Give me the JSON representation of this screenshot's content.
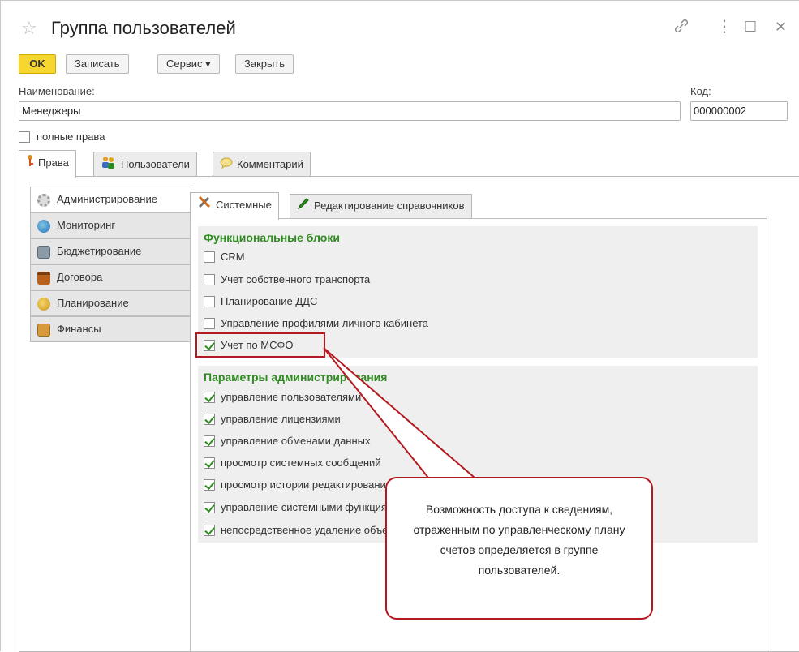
{
  "window": {
    "title": "Группа пользователей",
    "star_icon": "star-icon",
    "link_icon": "link-icon",
    "menu_icon": "more-vertical-icon",
    "maximize_icon": "maximize-icon",
    "close_icon": "close-icon",
    "link_glyph": "🔗",
    "menu_glyph": "⋮",
    "maximize_glyph": "☐",
    "close_glyph": "✕"
  },
  "toolbar": {
    "ok_label": "OK",
    "save_label": "Записать",
    "service_label": "Сервис ▾",
    "close_label": "Закрыть"
  },
  "form": {
    "name_label": "Наименование:",
    "name_value": "Менеджеры",
    "code_label": "Код:",
    "code_value": "000000002",
    "full_rights_label": "полные права",
    "full_rights_checked": false
  },
  "outer_tabs": [
    {
      "label": "Права",
      "icon": "key-icon",
      "active": true
    },
    {
      "label": "Пользователи",
      "icon": "users-icon",
      "active": false
    },
    {
      "label": "Комментарий",
      "icon": "comment-icon",
      "active": false
    }
  ],
  "side_items": [
    {
      "label": "Администрирование",
      "icon": "gear-icon",
      "active": true
    },
    {
      "label": "Мониторинг",
      "icon": "globe-icon",
      "active": false
    },
    {
      "label": "Бюджетирование",
      "icon": "calculator-icon",
      "active": false
    },
    {
      "label": "Договора",
      "icon": "briefcase-icon",
      "active": false
    },
    {
      "label": "Планирование",
      "icon": "coins-icon",
      "active": false
    },
    {
      "label": "Финансы",
      "icon": "finance-icon",
      "active": false
    }
  ],
  "inner_tabs": [
    {
      "label": "Системные",
      "icon": "tools-icon",
      "active": true
    },
    {
      "label": "Редактирование справочников",
      "icon": "pencil-icon",
      "active": false
    }
  ],
  "functional_blocks": {
    "title": "Функциональные блоки",
    "items": [
      {
        "label": "CRM",
        "checked": false
      },
      {
        "label": "Учет собственного транспорта",
        "checked": false
      },
      {
        "label": "Планирование ДДС",
        "checked": false
      },
      {
        "label": "Управление профилями личного кабинета",
        "checked": false
      },
      {
        "label": "Учет по МСФО",
        "checked": true
      }
    ]
  },
  "admin_params": {
    "title": "Параметры администрирования",
    "items": [
      {
        "label": "управление пользователями",
        "checked": true
      },
      {
        "label": "управление лицензиями",
        "checked": true
      },
      {
        "label": "управление обменами данных",
        "checked": true
      },
      {
        "label": "просмотр системных сообщений",
        "checked": true
      },
      {
        "label": "просмотр истории редактирования",
        "checked": true
      },
      {
        "label": "управление системными функциями",
        "checked": true
      },
      {
        "label": "непосредственное удаление объектов",
        "checked": true
      }
    ]
  },
  "callout": {
    "text": "Возможность доступа к сведениям, отраженным по управленческому плану счетов определяется в группе пользователей."
  },
  "colors": {
    "accent_yellow": "#f7d72f",
    "green_title": "#2e8b1f",
    "callout_border": "#b3191e"
  }
}
